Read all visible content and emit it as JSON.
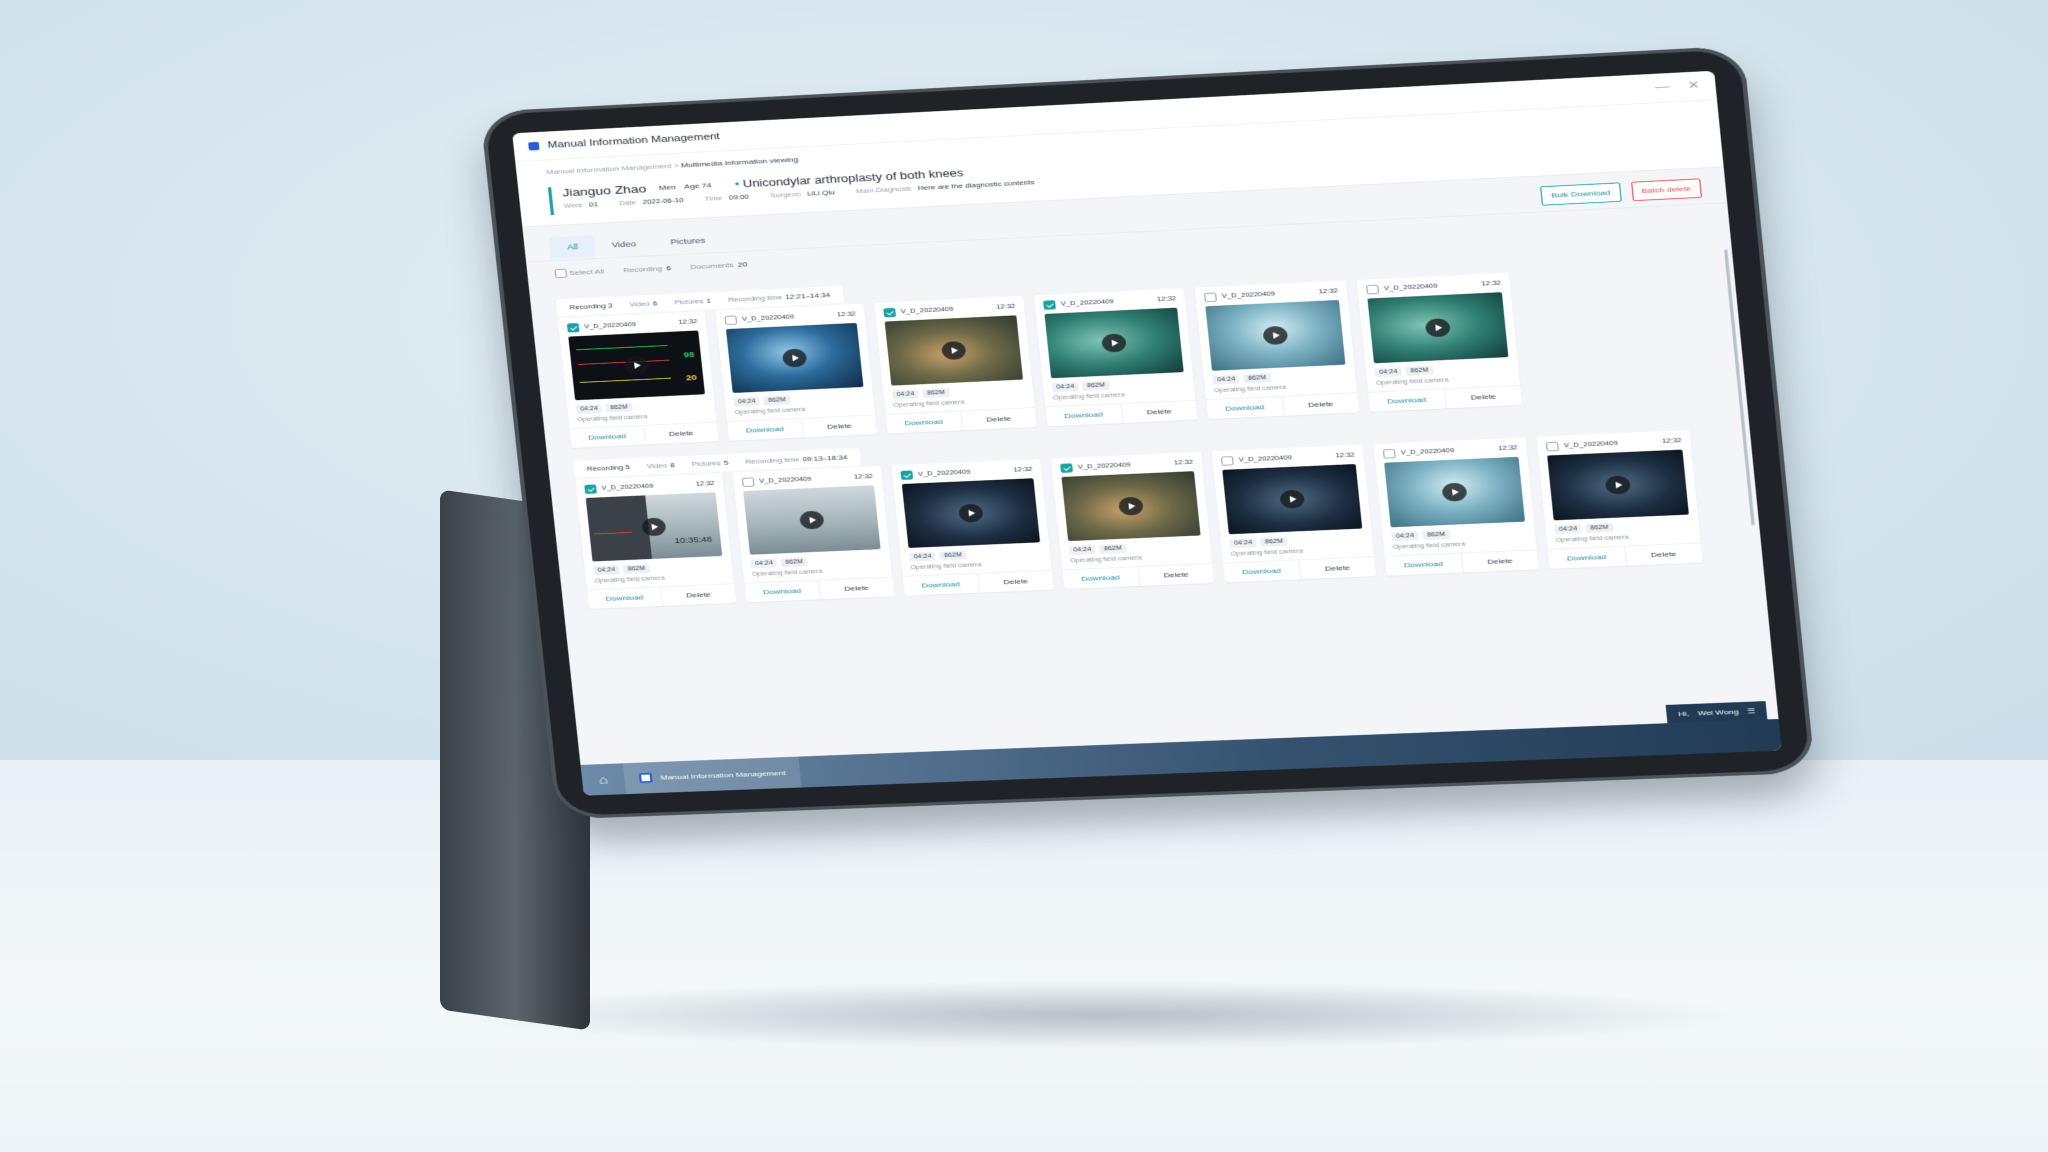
{
  "window": {
    "title": "Manual Information Management",
    "minimize_glyph": "—",
    "close_glyph": "✕"
  },
  "breadcrumb": {
    "parent": "Manual Information Management",
    "separator": ">",
    "current": "Multimedia information viewing"
  },
  "patient": {
    "name": "Jianguo Zhao",
    "gender": "Men",
    "age": "Age 74",
    "procedure": "Unicondylar arthroplasty of both knees",
    "ward_label": "Were",
    "ward_value": "01",
    "date_label": "Date",
    "date_value": "2022-06-10",
    "time_label": "Time",
    "time_value": "09:00",
    "surgeon_label": "Surgeon",
    "surgeon_value": "LiLi Qiu",
    "diagnosis_label": "Main Diagnosis",
    "diagnosis_value": "Here are the diagnostic contents"
  },
  "tabs": [
    {
      "label": "All",
      "active": true
    },
    {
      "label": "Video",
      "active": false
    },
    {
      "label": "Pictures",
      "active": false
    }
  ],
  "actions": {
    "bulk_download": "Bulk Download",
    "batch_delete": "Batch delete"
  },
  "filter": {
    "select_all": "Select All",
    "recording_label": "Recording",
    "recording_count": "6",
    "documents_label": "Documents",
    "documents_count": "20"
  },
  "groups": [
    {
      "title": "Recording 3",
      "video_label": "Video",
      "video_count": "6",
      "pictures_label": "Pictures",
      "pictures_count": "1",
      "time_label": "Recording time",
      "time_value": "12:21–14:34",
      "cards": [
        {
          "name": "V_D_20220409",
          "time": "12:32",
          "duration": "04:24",
          "size": "862M",
          "desc": "Operating field camera",
          "checked": true,
          "thumb": "patient-monitor"
        },
        {
          "name": "V_D_20220409",
          "time": "12:32",
          "duration": "04:24",
          "size": "862M",
          "desc": "Operating field camera",
          "checked": false,
          "thumb": "surgery-blue"
        },
        {
          "name": "V_D_20220409",
          "time": "12:32",
          "duration": "04:24",
          "size": "862M",
          "desc": "Operating field camera",
          "checked": true,
          "thumb": "surgery-orange"
        },
        {
          "name": "V_D_20220409",
          "time": "12:32",
          "duration": "04:24",
          "size": "862M",
          "desc": "Operating field camera",
          "checked": true,
          "thumb": "surgery-green"
        },
        {
          "name": "V_D_20220409",
          "time": "12:32",
          "duration": "04:24",
          "size": "862M",
          "desc": "Operating field camera",
          "checked": false,
          "thumb": "surgery-light"
        },
        {
          "name": "V_D_20220409",
          "time": "12:32",
          "duration": "04:24",
          "size": "862M",
          "desc": "Operating field camera",
          "checked": false,
          "thumb": "surgery-green"
        }
      ]
    },
    {
      "title": "Recording 5",
      "video_label": "Video",
      "video_count": "8",
      "pictures_label": "Pictures",
      "pictures_count": "5",
      "time_label": "Recording time",
      "time_value": "09:13–18:34",
      "cards": [
        {
          "name": "V_D_20220409",
          "time": "12:32",
          "duration": "04:24",
          "size": "862M",
          "desc": "Operating field camera",
          "checked": true,
          "thumb": "monitor-clock",
          "clock": "10:35:48"
        },
        {
          "name": "V_D_20220409",
          "time": "12:32",
          "duration": "04:24",
          "size": "862M",
          "desc": "Operating field camera",
          "checked": false,
          "thumb": "operating-room"
        },
        {
          "name": "V_D_20220409",
          "time": "12:32",
          "duration": "04:24",
          "size": "862M",
          "desc": "Operating field camera",
          "checked": true,
          "thumb": "surgery-dark"
        },
        {
          "name": "V_D_20220409",
          "time": "12:32",
          "duration": "04:24",
          "size": "862M",
          "desc": "Operating field camera",
          "checked": true,
          "thumb": "surgery-orange"
        },
        {
          "name": "V_D_20220409",
          "time": "12:32",
          "duration": "04:24",
          "size": "862M",
          "desc": "Operating field camera",
          "checked": false,
          "thumb": "surgery-dark"
        },
        {
          "name": "V_D_20220409",
          "time": "12:32",
          "duration": "04:24",
          "size": "862M",
          "desc": "Operating field camera",
          "checked": false,
          "thumb": "surgery-light"
        },
        {
          "name": "V_D_20220409",
          "time": "12:32",
          "duration": "04:24",
          "size": "862M",
          "desc": "Operating field camera",
          "checked": false,
          "thumb": "surgery-dark"
        }
      ]
    }
  ],
  "card_actions": {
    "download": "Download",
    "delete": "Delete"
  },
  "monitor_readout": {
    "value1": "98",
    "value2": "20"
  },
  "taskbar": {
    "home_icon": "home-icon",
    "app_label": "Manual Information Management",
    "greeting": "Hi,",
    "user": "Wei Wong",
    "menu_icon": "menu-icon"
  },
  "colors": {
    "accent": "#1ba2a4",
    "danger": "#e64b4b",
    "brand": "#2a5cd6"
  }
}
